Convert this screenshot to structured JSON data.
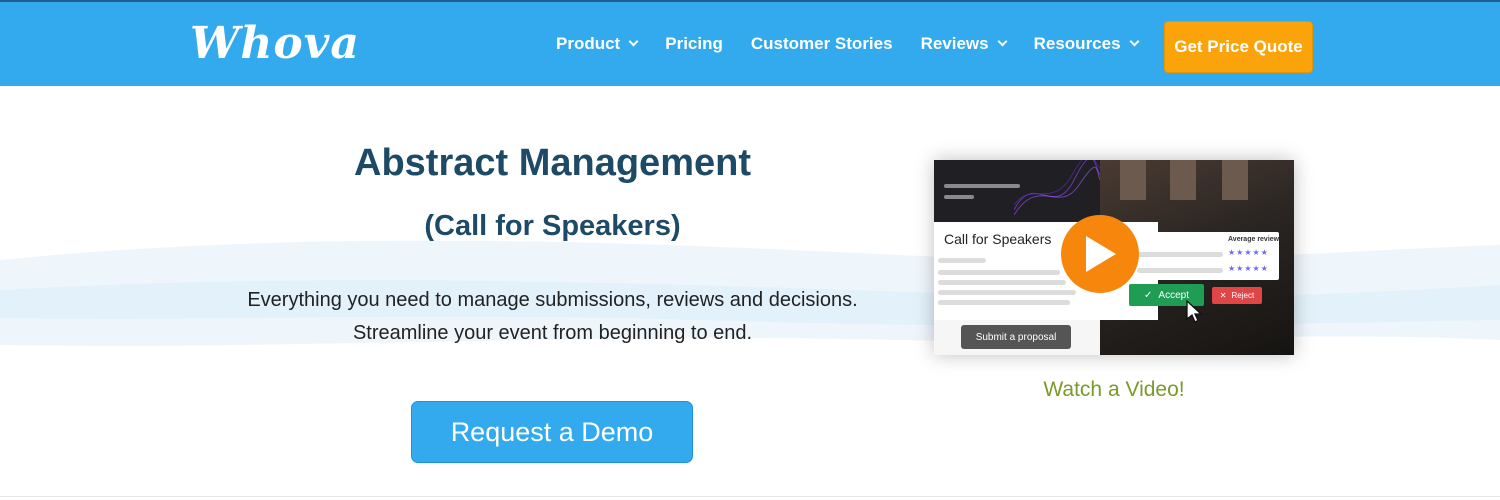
{
  "header": {
    "logo": "Whova",
    "nav": [
      {
        "label": "Product",
        "dropdown": true
      },
      {
        "label": "Pricing",
        "dropdown": false
      },
      {
        "label": "Customer Stories",
        "dropdown": false
      },
      {
        "label": "Reviews",
        "dropdown": true
      },
      {
        "label": "Resources",
        "dropdown": true
      }
    ],
    "cta_label": "Get Price Quote"
  },
  "hero": {
    "title": "Abstract Management",
    "subtitle": "(Call for Speakers)",
    "description_line1": "Everything you need to manage submissions, reviews and decisions.",
    "description_line2": "Streamline your event from beginning to end.",
    "demo_label": "Request a Demo"
  },
  "video": {
    "card_title": "Call for Speakers",
    "review_label": "Average review",
    "stars_row1": "★★★★★",
    "stars_row2": "★★★★★",
    "accept_label": "Accept",
    "reject_label": "Reject",
    "submit_label": "Submit a proposal",
    "watch_label": "Watch a Video!"
  },
  "colors": {
    "header_bg": "#33aaee",
    "cta_orange": "#fba30a",
    "title_navy": "#1d4a66",
    "play_orange": "#f7860c",
    "watch_green": "#7a9a2a"
  }
}
